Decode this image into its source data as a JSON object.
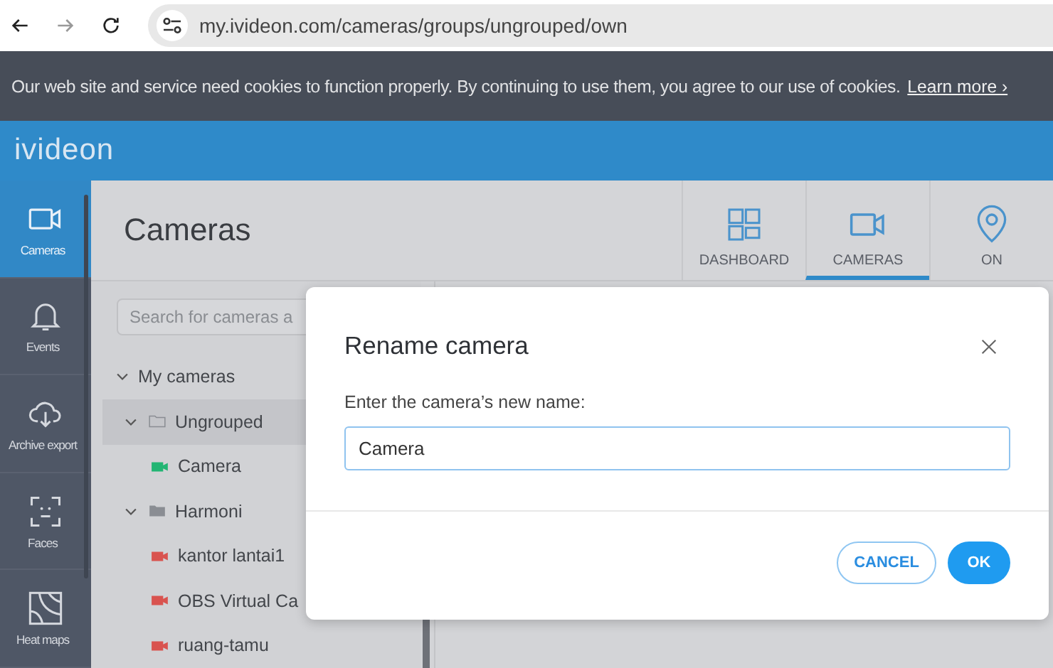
{
  "browser": {
    "url": "my.ivideon.com/cameras/groups/ungrouped/own"
  },
  "cookie_banner": {
    "text": "Our web site and service need cookies to function properly. By continuing to use them, you agree to our use of cookies.",
    "link": "Learn more ›"
  },
  "header": {
    "logo": "ivideon"
  },
  "sidebar": {
    "items": [
      {
        "label": "Cameras",
        "kind": "camera",
        "selected": true
      },
      {
        "label": "Events",
        "kind": "bell",
        "selected": false
      },
      {
        "label": "Archive export",
        "kind": "cloud",
        "selected": false
      },
      {
        "label": "Faces",
        "kind": "face",
        "selected": false
      },
      {
        "label": "Heat maps",
        "kind": "map",
        "selected": false
      }
    ]
  },
  "page": {
    "title": "Cameras",
    "tabs": [
      {
        "label": "DASHBOARD",
        "kind": "grid",
        "selected": false
      },
      {
        "label": "CAMERAS",
        "kind": "camera",
        "selected": true
      },
      {
        "label": "ON",
        "kind": "pin",
        "selected": false
      }
    ],
    "search": {
      "placeholder": "Search for cameras a"
    }
  },
  "tree": [
    {
      "label": "My cameras",
      "expanded": true,
      "selected": false,
      "children": [
        {
          "label": "Ungrouped",
          "kind": "folder-outline",
          "expanded": true,
          "selected": true,
          "children": [
            {
              "label": "Camera",
              "kind": "camera",
              "color": "#22b573",
              "selected": false
            }
          ]
        },
        {
          "label": "Harmoni",
          "kind": "folder-filled",
          "expanded": true,
          "selected": false,
          "children": [
            {
              "label": "kantor lantai1",
              "kind": "camera",
              "color": "#d9534f",
              "selected": false
            },
            {
              "label": "OBS Virtual Ca",
              "kind": "camera",
              "color": "#d9534f",
              "selected": false
            },
            {
              "label": "ruang-tamu",
              "kind": "camera",
              "color": "#d9534f",
              "selected": false
            }
          ]
        }
      ]
    }
  ],
  "modal": {
    "title": "Rename camera",
    "label": "Enter the camera’s new name:",
    "value": "Camera",
    "buttons": [
      {
        "label": "CANCEL",
        "kind": "secondary"
      },
      {
        "label": "OK",
        "kind": "primary"
      }
    ]
  }
}
